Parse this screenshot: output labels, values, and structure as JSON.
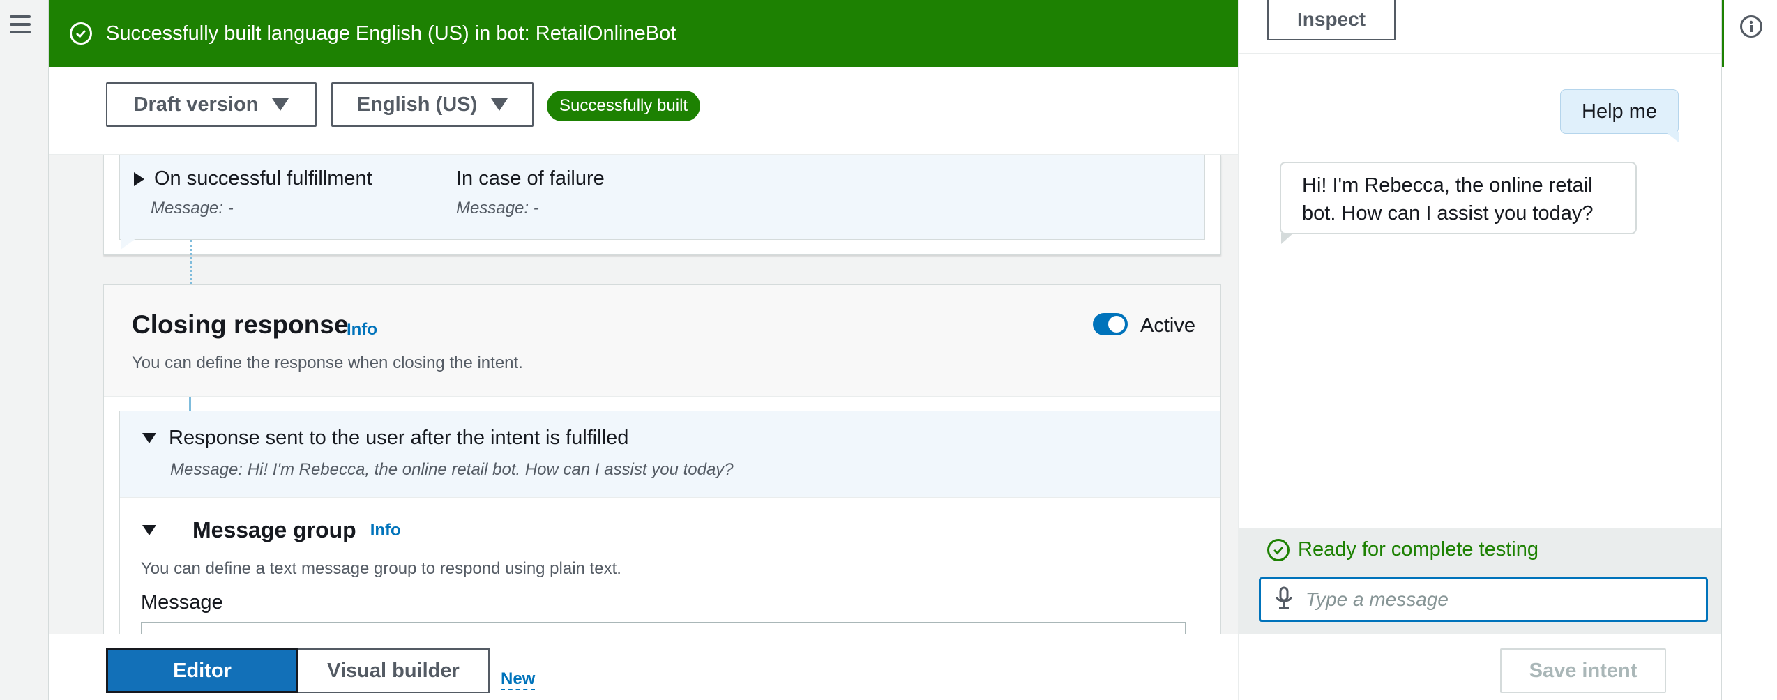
{
  "flash": {
    "message": "Successfully built language English (US) in bot: RetailOnlineBot"
  },
  "version_bar": {
    "version_label": "Draft version",
    "language_label": "English (US)",
    "status_badge": "Successfully built"
  },
  "fulfillment": {
    "success_title": "On successful fulfillment",
    "success_message": "Message: -",
    "failure_title": "In case of failure",
    "failure_message": "Message: -"
  },
  "closing_response": {
    "title": "Closing response",
    "info": "Info",
    "description": "You can define the response when closing the intent.",
    "toggle_label": "Active",
    "response_title": "Response sent to the user after the intent is fulfilled",
    "response_message": "Message: Hi! I'm Rebecca, the online retail bot. How can I assist you today?",
    "message_group_title": "Message group",
    "message_group_info": "Info",
    "message_group_description": "You can define a text message group to respond using plain text.",
    "message_label": "Message"
  },
  "bottom_bar": {
    "editor_tab": "Editor",
    "visual_builder_tab": "Visual builder",
    "new_link": "New"
  },
  "test_panel": {
    "inspect_button": "Inspect",
    "user_message": "Help me",
    "bot_message": "Hi! I'm Rebecca, the online retail bot. How can I assist you today?",
    "ready_status": "Ready for complete testing",
    "input_placeholder": "Type a message",
    "save_button": "Save intent"
  },
  "colors": {
    "success_green": "#1d8102",
    "accent_blue": "#0073bb",
    "editor_blue": "#1270b8"
  },
  "icons": [
    "hamburger-icon",
    "check-circle-icon",
    "caret-down-icon",
    "caret-right-icon",
    "microphone-icon",
    "info-circle-icon"
  ]
}
